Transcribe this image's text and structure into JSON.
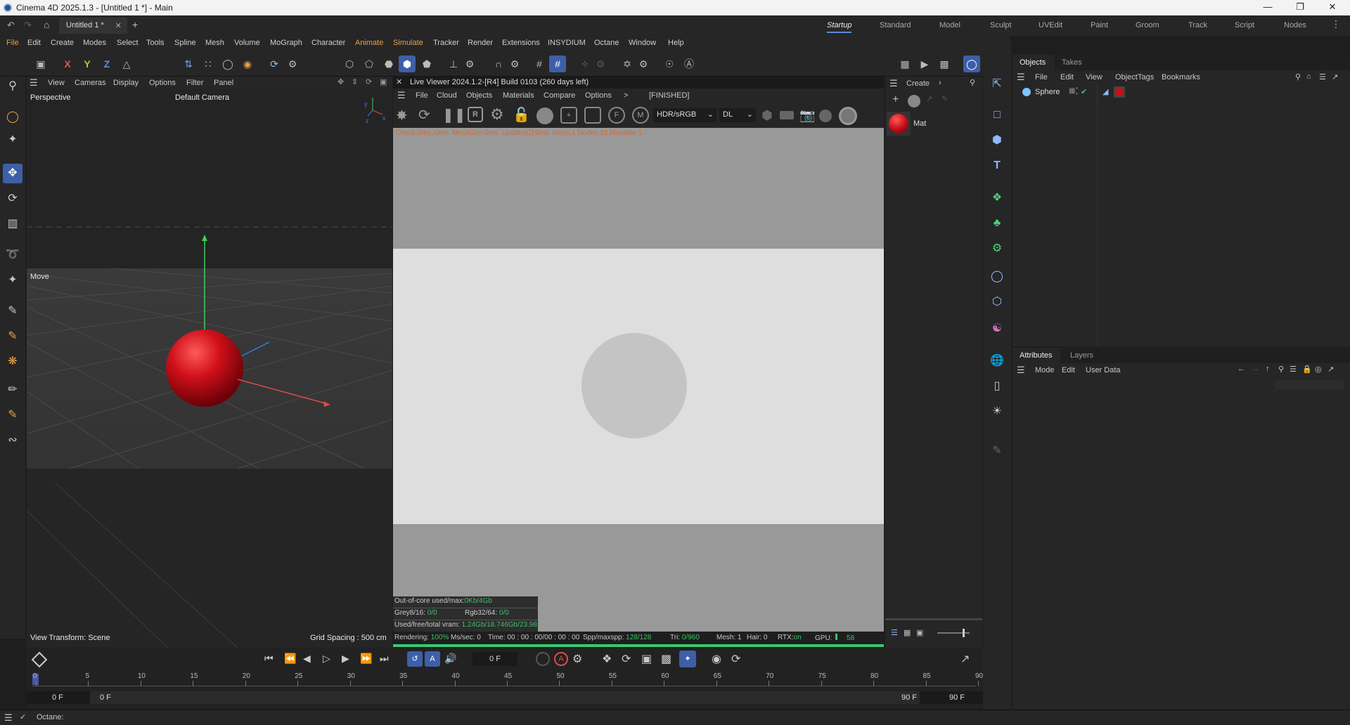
{
  "titlebar": {
    "title": "Cinema 4D 2025.1.3 - [Untitled 1 *] - Main"
  },
  "tabs": {
    "doc_tab": "Untitled 1 *"
  },
  "layouts": [
    "Startup",
    "Standard",
    "Model",
    "Sculpt",
    "UVEdit",
    "Paint",
    "Groom",
    "Track",
    "Script",
    "Nodes"
  ],
  "menu": [
    "File",
    "Edit",
    "Create",
    "Modes",
    "Select",
    "Tools",
    "Spline",
    "Mesh",
    "Volume",
    "MoGraph",
    "Character",
    "Animate",
    "Simulate",
    "Tracker",
    "Render",
    "Extensions",
    "INSYDIUM",
    "Octane",
    "Window",
    "Help"
  ],
  "toolbar": {
    "axis_x": "X",
    "axis_y": "Y",
    "axis_z": "Z"
  },
  "viewport": {
    "menu": [
      "View",
      "Cameras",
      "Display",
      "Options",
      "Filter",
      "Panel"
    ],
    "name": "Perspective",
    "camera": "Default Camera",
    "tool_label": "Move",
    "view_transform": "View Transform: Scene",
    "grid_spacing": "Grid Spacing : 500 cm"
  },
  "liveviewer": {
    "title": "Live Viewer 2024.1.2-[R4] Build 0103 (260 days left)",
    "menu": [
      "File",
      "Cloud",
      "Objects",
      "Materials",
      "Compare",
      "Options",
      ">"
    ],
    "status": "[FINISHED]",
    "colorspace": "HDR/sRGB",
    "kernel": "DL",
    "info_line": "Check:0ms./0ms. MeshGen:0ms. Update[C]:0ms. Mesh:1 Nodes:13 Movable:1",
    "stats": {
      "ooc_label": "Out-of-core used/max:",
      "ooc_val": "0Kb/4Gb",
      "grey_label": "Grey8/16:",
      "grey_val": "0/0",
      "rgb_label": "Rgb32/64:",
      "rgb_val": "0/0",
      "vram_label": "Used/free/total vram:",
      "vram_val": "1.24Gb/18.746Gb/23.98"
    },
    "render_bar": {
      "rendering_label": "Rendering:",
      "rendering_val": "100%",
      "ms_label": "Ms/sec:",
      "ms_val": "0",
      "time_label": "Time:",
      "time_val": "00 : 00 : 00/00 : 00 : 00",
      "spp_label": "Spp/maxspp:",
      "spp_val": "128/128",
      "tri_label": "Tri:",
      "tri_val": "0/960",
      "mesh_label": "Mesh:",
      "mesh_val": "1",
      "hair_label": "Hair:",
      "hair_val": "0",
      "rtx_label": "RTX:",
      "rtx_val": "on",
      "gpu_label": "GPU:",
      "gpu_val": "58"
    }
  },
  "matpanel": {
    "create_label": "Create",
    "material_name": "Mat"
  },
  "objects": {
    "tabs": [
      "Objects",
      "Takes"
    ],
    "menu": [
      "File",
      "Edit",
      "View",
      "Object",
      "Tags",
      "Bookmarks"
    ],
    "items": [
      {
        "name": "Sphere"
      }
    ]
  },
  "attributes": {
    "tabs": [
      "Attributes",
      "Layers"
    ],
    "menu": [
      "Mode",
      "Edit",
      "User Data"
    ]
  },
  "timeline": {
    "current_frame": "0 F",
    "ticks": [
      "0",
      "5",
      "10",
      "15",
      "20",
      "25",
      "30",
      "35",
      "40",
      "45",
      "50",
      "55",
      "60",
      "65",
      "70",
      "75",
      "80",
      "85",
      "90"
    ],
    "start_field": "0 F",
    "start_field2": "0 F",
    "end_field": "90 F",
    "end_field2": "90 F"
  },
  "statusbar": {
    "text": "Octane:"
  },
  "colors": {
    "accent": "#3d5fa8",
    "sphere": "#c8101a",
    "progress": "#38c870"
  }
}
